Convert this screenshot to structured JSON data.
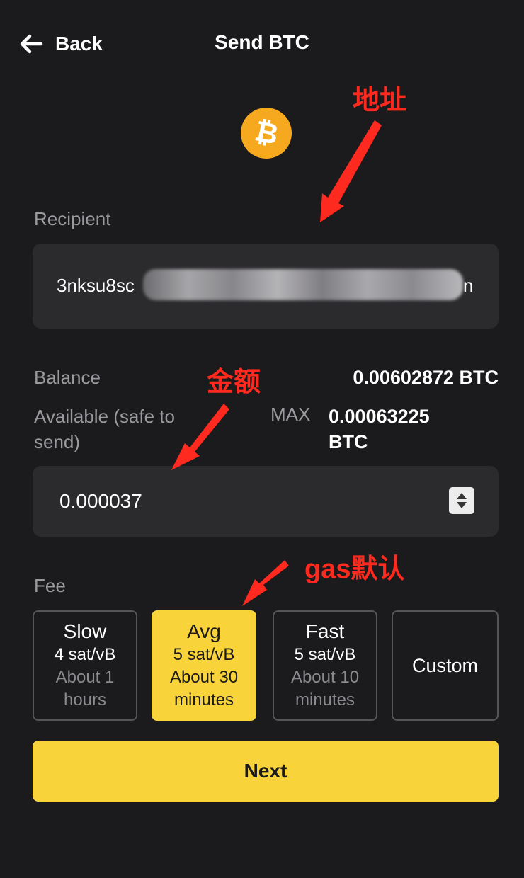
{
  "header": {
    "back_label": "Back",
    "title": "Send BTC"
  },
  "coin": {
    "symbol": "₿",
    "color": "#f6a91e"
  },
  "recipient": {
    "label": "Recipient",
    "value_prefix": "3nksu8sc",
    "value_suffix": "n"
  },
  "balance": {
    "label": "Balance",
    "value": "0.00602872 BTC"
  },
  "available": {
    "label": "Available (safe to send)",
    "max_label": "MAX",
    "value": "0.00063225 BTC"
  },
  "amount": {
    "value": "0.000037"
  },
  "fee": {
    "label": "Fee",
    "options": [
      {
        "name": "Slow",
        "rate": "4 sat/vB",
        "time": "About 1 hours",
        "selected": false
      },
      {
        "name": "Avg",
        "rate": "5 sat/vB",
        "time": "About 30 minutes",
        "selected": true
      },
      {
        "name": "Fast",
        "rate": "5 sat/vB",
        "time": "About 10 minutes",
        "selected": false
      },
      {
        "name": "Custom",
        "selected": false
      }
    ]
  },
  "next_button": {
    "label": "Next"
  },
  "annotations": {
    "address": "地址",
    "amount": "金额",
    "gas": "gas默认",
    "color": "#ff2a1f"
  },
  "colors": {
    "background": "#1b1a1c",
    "field": "#2b2a2d",
    "accent": "#f8d33a",
    "muted_text": "#9a999d"
  }
}
